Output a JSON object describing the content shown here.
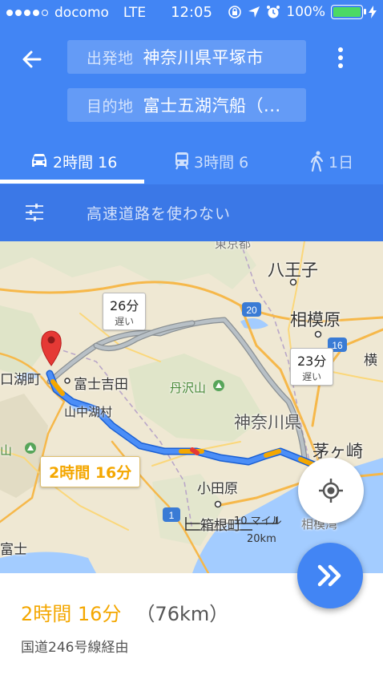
{
  "status_bar": {
    "carrier": "docomo",
    "network": "LTE",
    "time": "12:05",
    "battery": "100%"
  },
  "directions": {
    "origin_label": "出発地",
    "origin_value": "神奈川県平塚市",
    "destination_label": "目的地",
    "destination_value": "富士五湖汽船（..."
  },
  "modes": [
    {
      "label": "2時間 16",
      "icon": "car-icon",
      "selected": true
    },
    {
      "label": "3時間 6",
      "icon": "train-icon",
      "selected": false
    },
    {
      "label": "1日",
      "icon": "walk-icon",
      "selected": false
    }
  ],
  "options": {
    "label": "高速道路を使わない"
  },
  "map": {
    "places": {
      "hachioji": "八王子",
      "sagamihara": "相模原",
      "yoko": "横",
      "kawaguchiko": "口湖町",
      "fujiyoshida": "富士吉田",
      "yamanakako": "山中湖村",
      "tanzawa": "丹沢山",
      "kanagawa": "神奈川県",
      "chigasaki": "茅ヶ崎",
      "odawara": "小田原",
      "hakone": "箱根町",
      "sagamiwan": "相模湾",
      "yama": "山",
      "fuji": "富士",
      "tokyo": "東京都"
    },
    "road_shields": [
      "20",
      "16",
      "1"
    ],
    "alternatives": [
      {
        "time": "26分",
        "note": "遅い"
      },
      {
        "time": "23分",
        "note": "遅い"
      }
    ],
    "route_time": "2時間 16分",
    "scale": {
      "miles": "10 マイル",
      "km": "20km"
    },
    "colors": {
      "route": "#4285f4",
      "alt_route": "#9aa0a6",
      "traffic": "#f4a700"
    }
  },
  "summary": {
    "duration": "2時間 16分",
    "distance": "（76km）",
    "via": "国道246号線経由"
  }
}
